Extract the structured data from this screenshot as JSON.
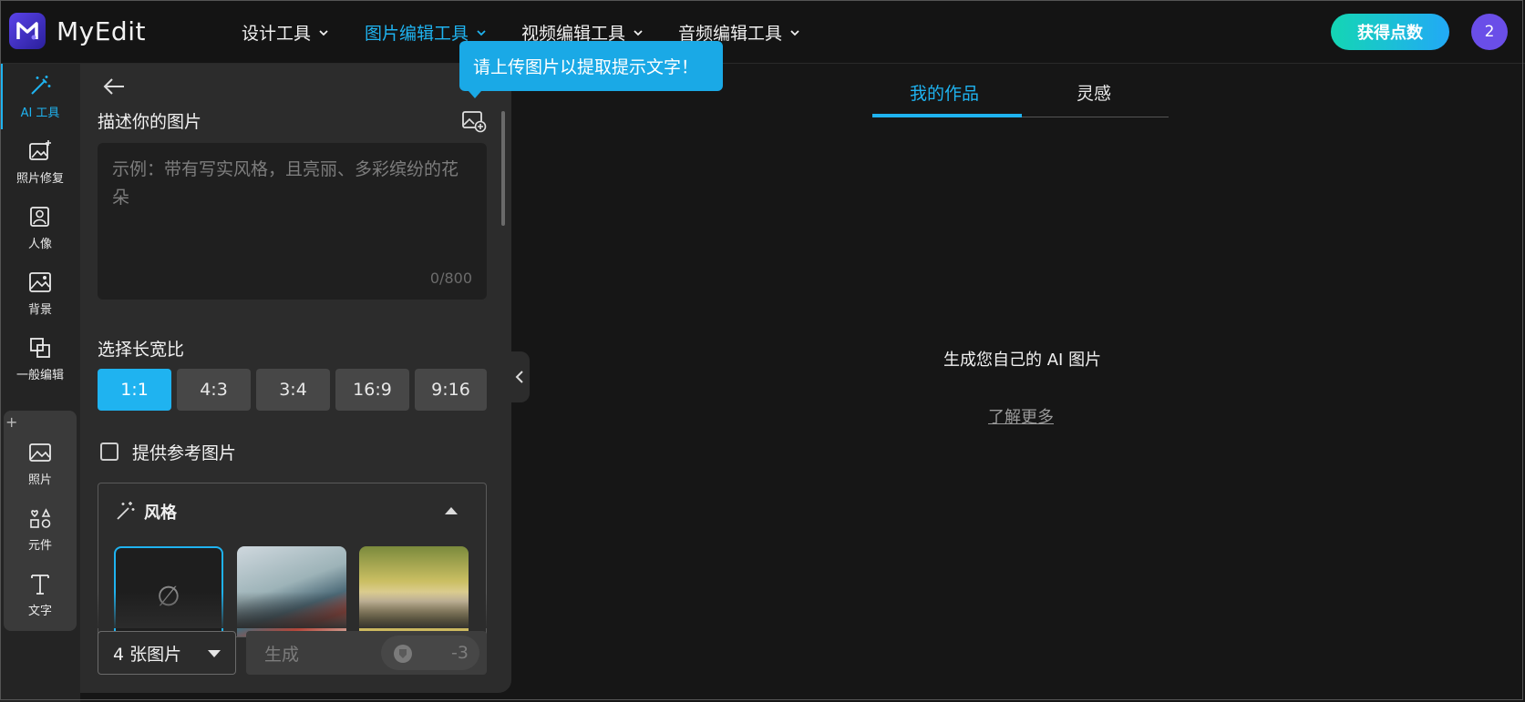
{
  "app": {
    "name": "MyEdit",
    "logo_letter": "M"
  },
  "header": {
    "nav": [
      {
        "label": "设计工具",
        "active": false
      },
      {
        "label": "图片编辑工具",
        "active": true
      },
      {
        "label": "视频编辑工具",
        "active": false
      },
      {
        "label": "音频编辑工具",
        "active": false
      }
    ],
    "get_points_label": "获得点数",
    "avatar_text": "2"
  },
  "rail": {
    "items": [
      {
        "label": "AI 工具",
        "icon": "magic-wand-icon",
        "active": true
      },
      {
        "label": "照片修复",
        "icon": "photo-enhance-icon"
      },
      {
        "label": "人像",
        "icon": "portrait-icon"
      },
      {
        "label": "背景",
        "icon": "background-icon"
      },
      {
        "label": "一般编辑",
        "icon": "general-edit-icon"
      }
    ],
    "group_add": "+",
    "group_items": [
      {
        "label": "照片",
        "icon": "photo-icon"
      },
      {
        "label": "元件",
        "icon": "elements-icon"
      },
      {
        "label": "文字",
        "icon": "text-icon"
      }
    ]
  },
  "panel": {
    "describe_label": "描述你的图片",
    "prompt_placeholder": "示例：带有写实风格，且亮丽、多彩缤纷的花朵",
    "char_count": "0/800",
    "aspect_label": "选择长宽比",
    "aspect_ratios": [
      "1:1",
      "4:3",
      "3:4",
      "16:9",
      "9:16"
    ],
    "selected_ratio": "1:1",
    "reference_label": "提供参考图片",
    "reference_checked": false,
    "style_label": "风格",
    "style_none_symbol": "∅",
    "count_select": "4 张图片",
    "generate_label": "生成",
    "cost": "-3"
  },
  "tooltip": {
    "text": "请上传图片以提取提示文字！"
  },
  "main": {
    "tabs": [
      {
        "label": "我的作品",
        "active": true
      },
      {
        "label": "灵感",
        "active": false
      }
    ],
    "empty_title": "生成您自己的 AI 图片",
    "learn_more": "了解更多"
  },
  "colors": {
    "accent": "#1fb3f0",
    "points_gradient_start": "#14d6b4",
    "points_gradient_end": "#22a9f6",
    "avatar": "#6a4ee8"
  }
}
